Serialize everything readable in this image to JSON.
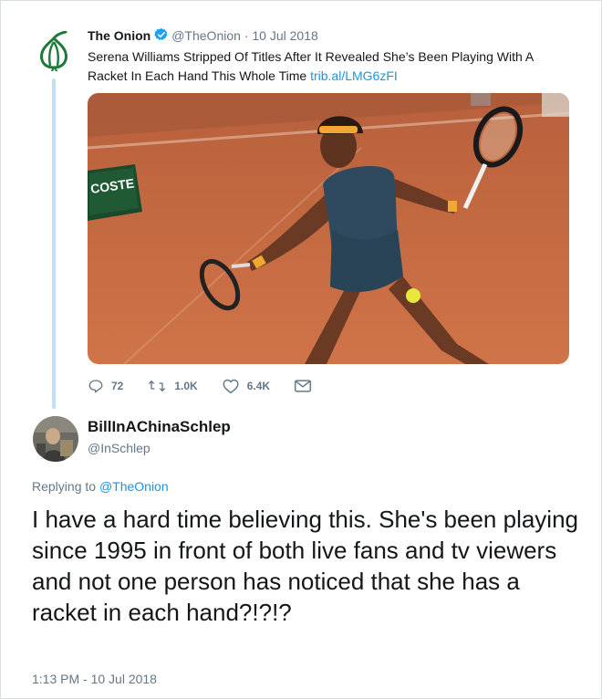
{
  "quoted_tweet": {
    "display_name": "The Onion",
    "handle": "@TheOnion",
    "separator": "·",
    "date": "10 Jul 2018",
    "text": "Serena Williams Stripped Of Titles After It Revealed She’s Been Playing With A Racket In Each Hand This Whole Time",
    "link": "trib.al/LMG6zFI",
    "media_sign_text": "COSTE",
    "stats": {
      "replies": "72",
      "retweets": "1.0K",
      "likes": "6.4K"
    },
    "icons": [
      "onion-logo-icon",
      "verified-icon",
      "reply-icon",
      "retweet-icon",
      "like-icon",
      "message-icon"
    ]
  },
  "reply": {
    "display_name": "BillInAChinaSchlep",
    "handle": "@InSchlep",
    "replying_prefix": "Replying to",
    "replying_to": "@TheOnion",
    "text": "I have a hard time believing this.  She's been playing since 1995 in front of both live fans and tv viewers and not one person has noticed that she has a racket in each hand?!?!?",
    "timestamp": "1:13 PM - 10 Jul 2018"
  },
  "colors": {
    "link_blue": "#1b95e0",
    "verified_blue": "#1da1f2",
    "thread_line": "#c2dff5",
    "muted_text": "#657786",
    "onion_green": "#1f7a3a",
    "clay_court": "#c96a40"
  }
}
